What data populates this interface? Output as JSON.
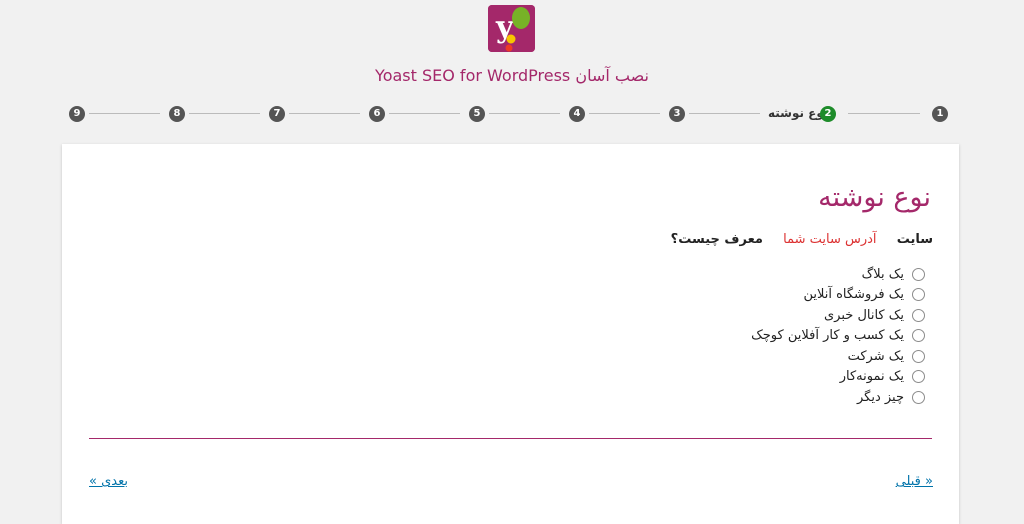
{
  "header": {
    "title": "Yoast SEO for WordPress نصب آسان"
  },
  "stepper": {
    "steps": [
      {
        "number": "1",
        "active": false
      },
      {
        "number": "2",
        "active": true,
        "label": "نوع نوشته"
      },
      {
        "number": "3",
        "active": false
      },
      {
        "number": "4",
        "active": false
      },
      {
        "number": "5",
        "active": false
      },
      {
        "number": "6",
        "active": false
      },
      {
        "number": "7",
        "active": false
      },
      {
        "number": "8",
        "active": false
      },
      {
        "number": "9",
        "active": false
      }
    ]
  },
  "content": {
    "heading": "نوع نوشته",
    "intro": {
      "part1": "سایت",
      "part2": "آدرس سایت شما",
      "part3": "معرف چیست؟"
    },
    "options": [
      "یک بلاگ",
      "یک فروشگاه آنلاین",
      "یک کانال خبری",
      "یک کسب و کار آفلاین کوچک",
      "یک شرکت",
      "یک نمونه‌کار",
      "چیز دیگر"
    ]
  },
  "nav": {
    "prev": "« قبلی",
    "next": "بعدی »"
  },
  "colors": {
    "brand": "#a4286a",
    "active_step": "#1e8c2a",
    "link": "#0073aa",
    "highlight": "#dc3232"
  }
}
